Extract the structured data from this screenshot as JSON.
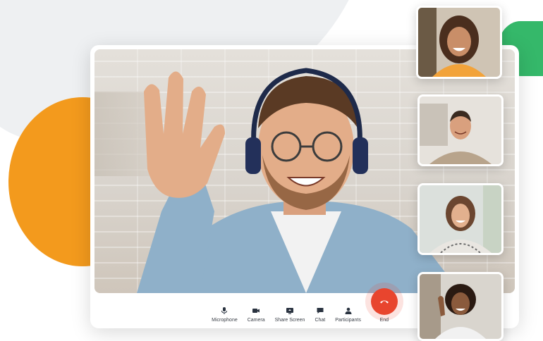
{
  "toolbar": {
    "microphone_label": "Microphone",
    "camera_label": "Camera",
    "share_screen_label": "Share Screen",
    "chat_label": "Chat",
    "participants_label": "Participants",
    "end_label": "End"
  },
  "icons": {
    "microphone": "microphone-icon",
    "camera": "camera-icon",
    "share_screen": "share-screen-icon",
    "chat": "chat-icon",
    "participants": "participants-icon",
    "end": "phone-hangup-icon"
  },
  "colors": {
    "accent_orange": "#f39a1d",
    "accent_green": "#35b86a",
    "end_call_red": "#e8452e"
  }
}
